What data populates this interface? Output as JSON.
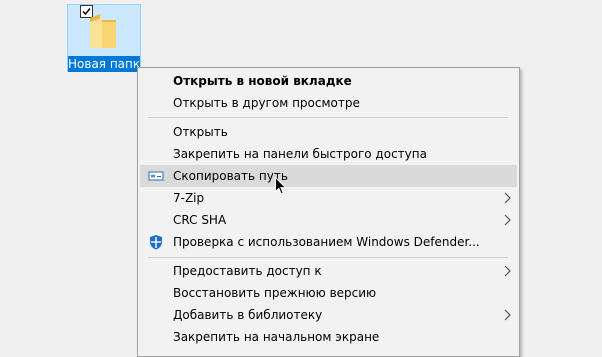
{
  "desktop_icon": {
    "label": "Новая папка",
    "checked": true
  },
  "context_menu": {
    "groups": [
      [
        {
          "label": "Открыть в новой вкладке",
          "bold": true
        },
        {
          "label": "Открыть в другом просмотре"
        }
      ],
      [
        {
          "label": "Открыть"
        },
        {
          "label": "Закрепить на панели быстрого доступа"
        },
        {
          "label": "Скопировать путь",
          "icon": "copy-path-icon",
          "highlighted": true
        },
        {
          "label": "7-Zip",
          "submenu": true
        },
        {
          "label": "CRC SHA",
          "submenu": true
        },
        {
          "label": "Проверка с использованием Windows Defender...",
          "icon": "windows-defender-icon"
        }
      ],
      [
        {
          "label": "Предоставить доступ к",
          "submenu": true
        },
        {
          "label": "Восстановить прежнюю версию"
        },
        {
          "label": "Добавить в библиотеку",
          "submenu": true
        },
        {
          "label": "Закрепить на начальном экране"
        }
      ]
    ]
  },
  "colors": {
    "selection_bg": "#cce8ff",
    "label_bg": "#0078d7",
    "menu_bg": "#f2f2f2",
    "hover_bg": "#dadada"
  }
}
